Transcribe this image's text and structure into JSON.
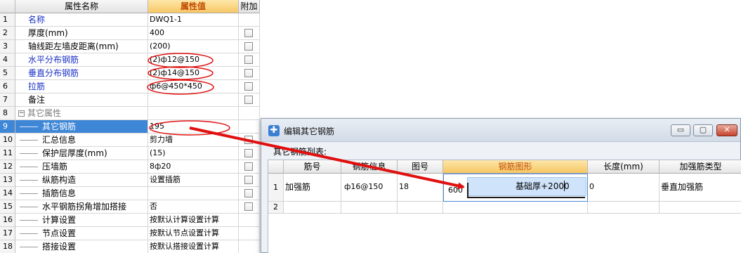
{
  "property_grid": {
    "headers": {
      "name": "属性名称",
      "value": "属性值",
      "attach": "附加"
    },
    "rows": [
      {
        "num": "1",
        "name": "名称",
        "value": "DWQ1-1",
        "style": "blue",
        "check": false
      },
      {
        "num": "2",
        "name": "厚度(mm)",
        "value": "400",
        "style": "",
        "check": true
      },
      {
        "num": "3",
        "name": "轴线距左墙皮距离(mm)",
        "value": "(200)",
        "style": "",
        "check": true
      },
      {
        "num": "4",
        "name": "水平分布钢筋",
        "value": "(2)ф12@150",
        "style": "blue",
        "check": true
      },
      {
        "num": "5",
        "name": "垂直分布钢筋",
        "value": "(2)ф14@150",
        "style": "blue",
        "check": true
      },
      {
        "num": "6",
        "name": "拉筋",
        "value": "ф6@450*450",
        "style": "blue",
        "check": true
      },
      {
        "num": "7",
        "name": "备注",
        "value": "",
        "style": "",
        "check": true
      },
      {
        "num": "8",
        "name": "其它属性",
        "value": "",
        "style": "group",
        "check": false
      },
      {
        "num": "9",
        "name": "其它钢筋",
        "value": "195",
        "style": "child sel",
        "check": false
      },
      {
        "num": "10",
        "name": "汇总信息",
        "value": "剪力墙",
        "style": "child",
        "check": true
      },
      {
        "num": "11",
        "name": "保护层厚度(mm)",
        "value": "(15)",
        "style": "child",
        "check": true
      },
      {
        "num": "12",
        "name": "压墙筋",
        "value": "8ф20",
        "style": "child",
        "check": true
      },
      {
        "num": "13",
        "name": "纵筋构造",
        "value": "设置插筋",
        "style": "child",
        "check": true
      },
      {
        "num": "14",
        "name": "插筋信息",
        "value": "",
        "style": "child",
        "check": true
      },
      {
        "num": "15",
        "name": "水平钢筋拐角增加搭接",
        "value": "否",
        "style": "child",
        "check": true
      },
      {
        "num": "16",
        "name": "计算设置",
        "value": "按默认计算设置计算",
        "style": "child",
        "check": false
      },
      {
        "num": "17",
        "name": "节点设置",
        "value": "按默认节点设置计算",
        "style": "child",
        "check": false
      },
      {
        "num": "18",
        "name": "搭接设置",
        "value": "按默认搭接设置计算",
        "style": "child",
        "check": false
      }
    ],
    "group_expander": "−"
  },
  "dialog": {
    "title": "编辑其它钢筋",
    "icon_glyph": "✚",
    "minimize": "▭",
    "maximize": "▢",
    "close": "✕",
    "list_label": "其它钢筋列表:",
    "columns": [
      "筋号",
      "钢筋信息",
      "图号",
      "钢筋图形",
      "长度(mm)",
      "加强筋类型"
    ],
    "rows": [
      {
        "num": "1",
        "bar_no": "加强筋",
        "info": "ф16@150",
        "fig_no": "18",
        "shape_left": "600",
        "shape_text": "基础厚+2000",
        "length": "0",
        "type": "垂直加强筋"
      },
      {
        "num": "2",
        "bar_no": "",
        "info": "",
        "fig_no": "",
        "shape_left": "",
        "shape_text": "",
        "length": "",
        "type": ""
      }
    ]
  },
  "annotation_color": "#e01010"
}
